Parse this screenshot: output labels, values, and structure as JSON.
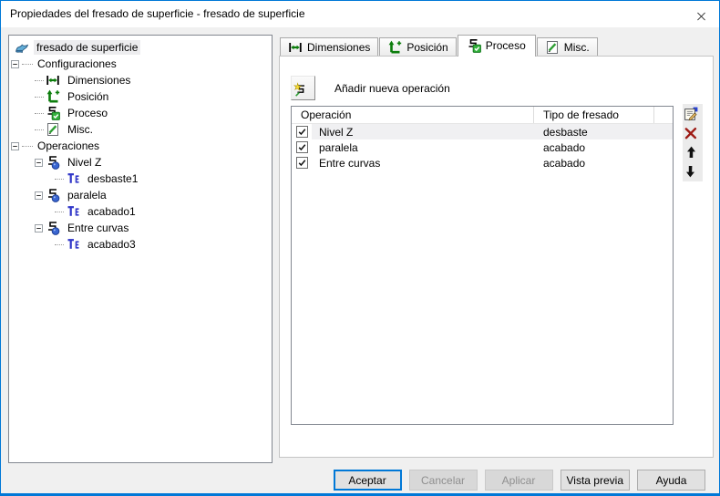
{
  "window": {
    "title": "Propiedades del fresado de superficie - fresado de superficie"
  },
  "colors": {
    "accent": "#0078d7",
    "dialog_bg": "#f0f0f0",
    "titlebar_bg": "#ffffff",
    "panel_bg": "#ffffff",
    "selection_bg": "#ededef",
    "icon_green": "#0c7d0c",
    "delete_red": "#9e1b15",
    "disabled_text": "#8f8f8f"
  },
  "tree": {
    "items": [
      {
        "id": "fresado-de-superficie",
        "label": "fresado de superficie",
        "icon": "surface",
        "level": 0,
        "selected": true
      },
      {
        "id": "configuraciones",
        "label": "Configuraciones",
        "level": 1,
        "expander": true
      },
      {
        "id": "dimensiones",
        "label": "Dimensiones",
        "icon": "dimensions",
        "level": 2
      },
      {
        "id": "posicion",
        "label": "Posición",
        "icon": "position",
        "level": 2
      },
      {
        "id": "proceso",
        "label": "Proceso",
        "icon": "process",
        "level": 2
      },
      {
        "id": "misc",
        "label": "Misc.",
        "icon": "misc",
        "level": 2
      },
      {
        "id": "operaciones",
        "label": "Operaciones",
        "level": 1,
        "expander": true
      },
      {
        "id": "nivel-z",
        "label": "Nivel Z",
        "icon": "operation",
        "level": 2,
        "expander": true
      },
      {
        "id": "desbaste1",
        "label": "desbaste1",
        "icon": "tool",
        "level": 3
      },
      {
        "id": "paralela",
        "label": "paralela",
        "icon": "operation",
        "level": 2,
        "expander": true
      },
      {
        "id": "acabado1",
        "label": "acabado1",
        "icon": "tool",
        "level": 3
      },
      {
        "id": "entre-curvas",
        "label": "Entre curvas",
        "icon": "operation",
        "level": 2,
        "expander": true
      },
      {
        "id": "acabado3",
        "label": "acabado3",
        "icon": "tool",
        "level": 3
      }
    ]
  },
  "tabs": [
    {
      "id": "dimensiones",
      "label": "Dimensiones",
      "icon": "dimensions",
      "active": false
    },
    {
      "id": "posicion",
      "label": "Posición",
      "icon": "position",
      "active": false
    },
    {
      "id": "proceso",
      "label": "Proceso",
      "icon": "process",
      "active": true
    },
    {
      "id": "misc",
      "label": "Misc.",
      "icon": "misc",
      "active": false
    }
  ],
  "process_tab": {
    "add_button_label": "Añadir nueva operación",
    "table": {
      "columns": [
        "Operación",
        "Tipo de fresado"
      ],
      "rows": [
        {
          "checked": true,
          "operacion": "Nivel Z",
          "tipo": "desbaste",
          "selected": true
        },
        {
          "checked": true,
          "operacion": "paralela",
          "tipo": "acabado",
          "selected": false
        },
        {
          "checked": true,
          "operacion": "Entre curvas",
          "tipo": "acabado",
          "selected": false
        }
      ]
    },
    "side_toolbar": [
      {
        "id": "edit-operation",
        "icon": "edit"
      },
      {
        "id": "delete-operation",
        "icon": "delete"
      },
      {
        "id": "move-up",
        "icon": "up"
      },
      {
        "id": "move-down",
        "icon": "down"
      }
    ]
  },
  "footer": {
    "buttons": [
      {
        "id": "accept",
        "label": "Aceptar",
        "state": "focused"
      },
      {
        "id": "cancel",
        "label": "Cancelar",
        "state": "disabled"
      },
      {
        "id": "apply",
        "label": "Aplicar",
        "state": "disabled"
      },
      {
        "id": "preview",
        "label": "Vista previa",
        "state": "normal"
      },
      {
        "id": "help",
        "label": "Ayuda",
        "state": "normal"
      }
    ]
  }
}
